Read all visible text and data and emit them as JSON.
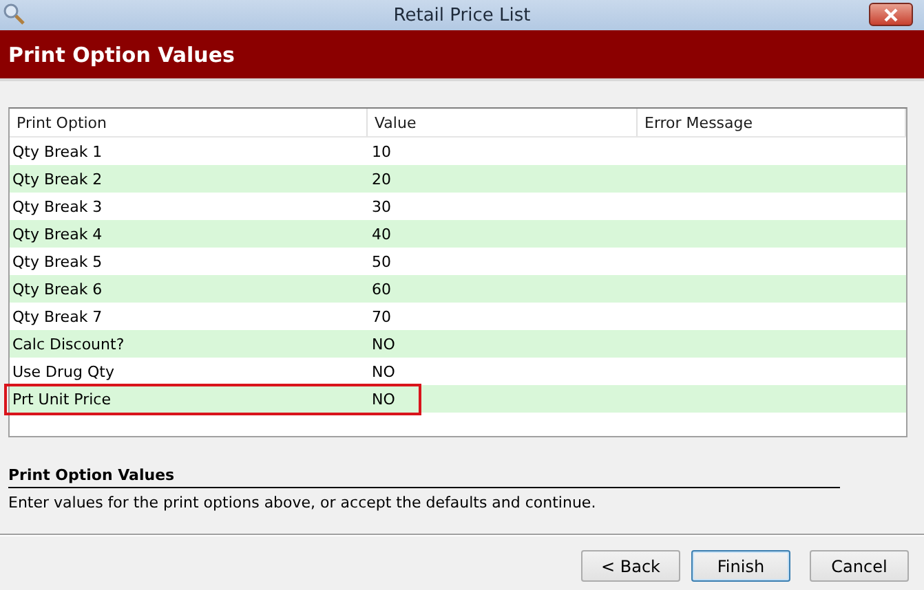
{
  "window": {
    "title": "Retail Price List"
  },
  "header": {
    "title": "Print Option Values"
  },
  "table": {
    "columns": [
      "Print Option",
      "Value",
      "Error Message"
    ],
    "rows": [
      {
        "option": "Qty Break 1",
        "value": "10",
        "highlighted": false
      },
      {
        "option": "Qty Break 2",
        "value": "20",
        "highlighted": false
      },
      {
        "option": "Qty Break 3",
        "value": "30",
        "highlighted": false
      },
      {
        "option": "Qty Break 4",
        "value": "40",
        "highlighted": false
      },
      {
        "option": "Qty Break 5",
        "value": "50",
        "highlighted": false
      },
      {
        "option": "Qty Break 6",
        "value": "60",
        "highlighted": false
      },
      {
        "option": "Qty Break 7",
        "value": "70",
        "highlighted": false
      },
      {
        "option": "Calc Discount?",
        "value": "NO",
        "highlighted": false
      },
      {
        "option": "Use Drug Qty",
        "value": "NO",
        "highlighted": false
      },
      {
        "option": "Prt Unit Price",
        "value": "NO",
        "highlighted": true
      }
    ]
  },
  "description": {
    "title": "Print Option Values",
    "text": "Enter values for the print options above, or accept the defaults and continue."
  },
  "buttons": [
    {
      "label": "< Back",
      "default": false
    },
    {
      "label": "Finish",
      "default": true
    },
    {
      "label": "Cancel",
      "default": false
    }
  ]
}
